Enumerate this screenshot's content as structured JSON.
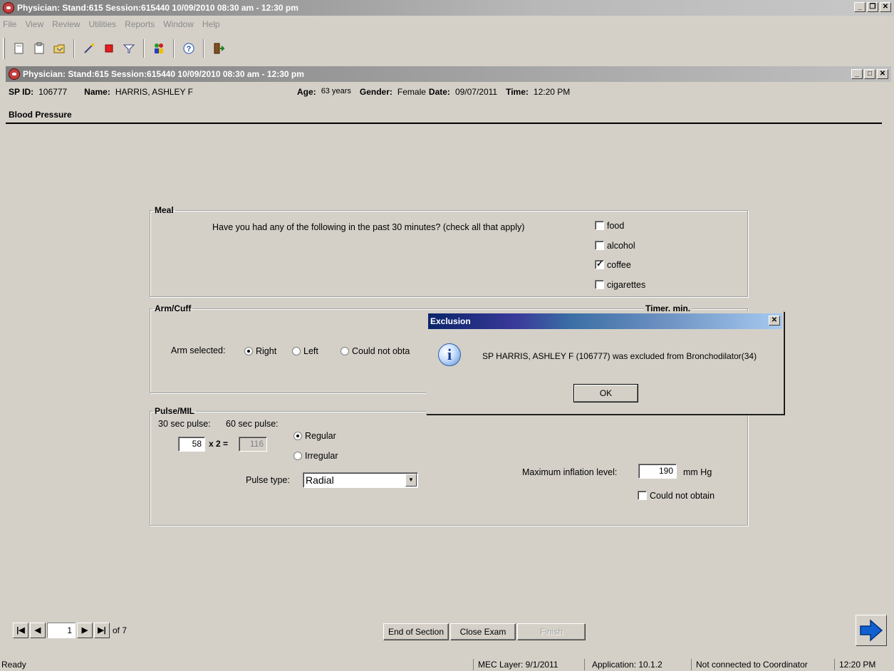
{
  "app": {
    "title": "Physician: Stand:615 Session:615440 10/09/2010 08:30 am - 12:30 pm",
    "menu": [
      "File",
      "View",
      "Review",
      "Utilities",
      "Reports",
      "Window",
      "Help"
    ]
  },
  "child": {
    "title": "Physician: Stand:615 Session:615440 10/09/2010 08:30 am - 12:30 pm"
  },
  "patient": {
    "sp_id_label": "SP ID:",
    "sp_id": "106777",
    "name_label": "Name:",
    "name": "HARRIS, ASHLEY F",
    "age_label": "Age:",
    "age": "63 years",
    "gender_label": "Gender:",
    "gender": "Female",
    "date_label": "Date:",
    "date": "09/07/2011",
    "time_label": "Time:",
    "time": "12:20 PM"
  },
  "section_title": "Blood Pressure",
  "meal": {
    "legend": "Meal",
    "question": "Have you had any of the following in the past 30 minutes? (check all that apply)",
    "options": [
      {
        "label": "food",
        "checked": false
      },
      {
        "label": "alcohol",
        "checked": false
      },
      {
        "label": "coffee",
        "checked": true
      },
      {
        "label": "cigarettes",
        "checked": false
      }
    ]
  },
  "arm": {
    "legend": "Arm/Cuff",
    "timer_legend": "Timer, min.",
    "arm_label": "Arm selected:",
    "options": [
      "Right",
      "Left",
      "Could not obta"
    ],
    "selected": "Right"
  },
  "pulse": {
    "legend": "Pulse/MIL",
    "label_30": "30 sec pulse:",
    "label_60": "60 sec pulse:",
    "value_30": "58",
    "multiplier": "x 2 =",
    "value_60": "116",
    "regular": "Regular",
    "irregular": "Irregular",
    "type_label": "Pulse type:",
    "type_value": "Radial",
    "mil_label": "Maximum inflation level:",
    "mil_value": "190",
    "mil_unit": "mm Hg",
    "could_not_obtain": "Could not obtain"
  },
  "nav": {
    "page": "1",
    "of_label": "of 7",
    "end_section": "End of Section",
    "close_exam": "Close Exam",
    "finish": "Finish"
  },
  "status": {
    "ready": "Ready",
    "mec_layer": "MEC Layer: 9/1/2011",
    "application": "Application: 10.1.2",
    "coordinator": "Not connected to Coordinator",
    "clock": "12:20 PM"
  },
  "dialog": {
    "title": "Exclusion",
    "message": "SP HARRIS, ASHLEY F (106777) was excluded from Bronchodilator(34)",
    "ok": "OK"
  }
}
